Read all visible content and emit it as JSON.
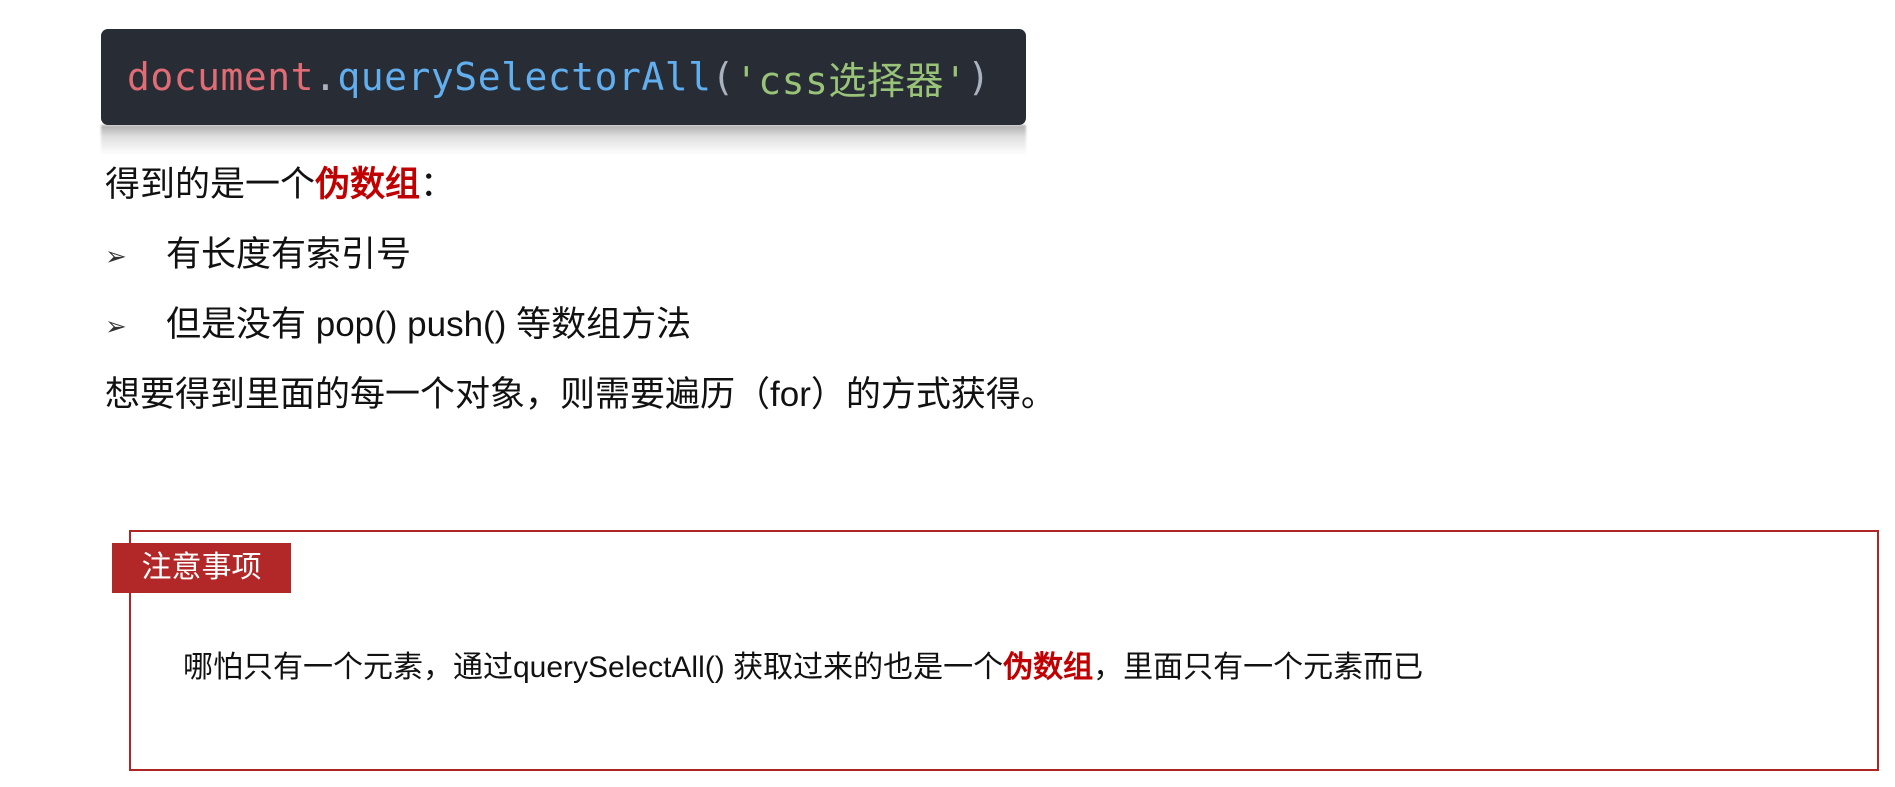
{
  "code": {
    "object": "document",
    "dot": ".",
    "method": "querySelectorAll",
    "open_paren": "(",
    "argument": "'css选择器'",
    "close_paren": ")"
  },
  "intro": {
    "prefix": "得到的是一个",
    "highlight": "伪数组",
    "suffix": "："
  },
  "bullets": [
    {
      "marker": "➢",
      "text": "有长度有索引号"
    },
    {
      "marker": "➢",
      "text": "但是没有 pop()   push() 等数组方法"
    }
  ],
  "conclusion": "想要得到里面的每一个对象，则需要遍历（for）的方式获得。",
  "notice": {
    "title": "注意事项",
    "prefix": "哪怕只有一个元素，通过querySelectAll() 获取过来的也是一个",
    "highlight": "伪数组",
    "suffix": "，里面只有一个元素而已"
  },
  "colors": {
    "code_background": "#282c34",
    "highlight_red": "#c00000",
    "notice_red": "#b22727"
  }
}
